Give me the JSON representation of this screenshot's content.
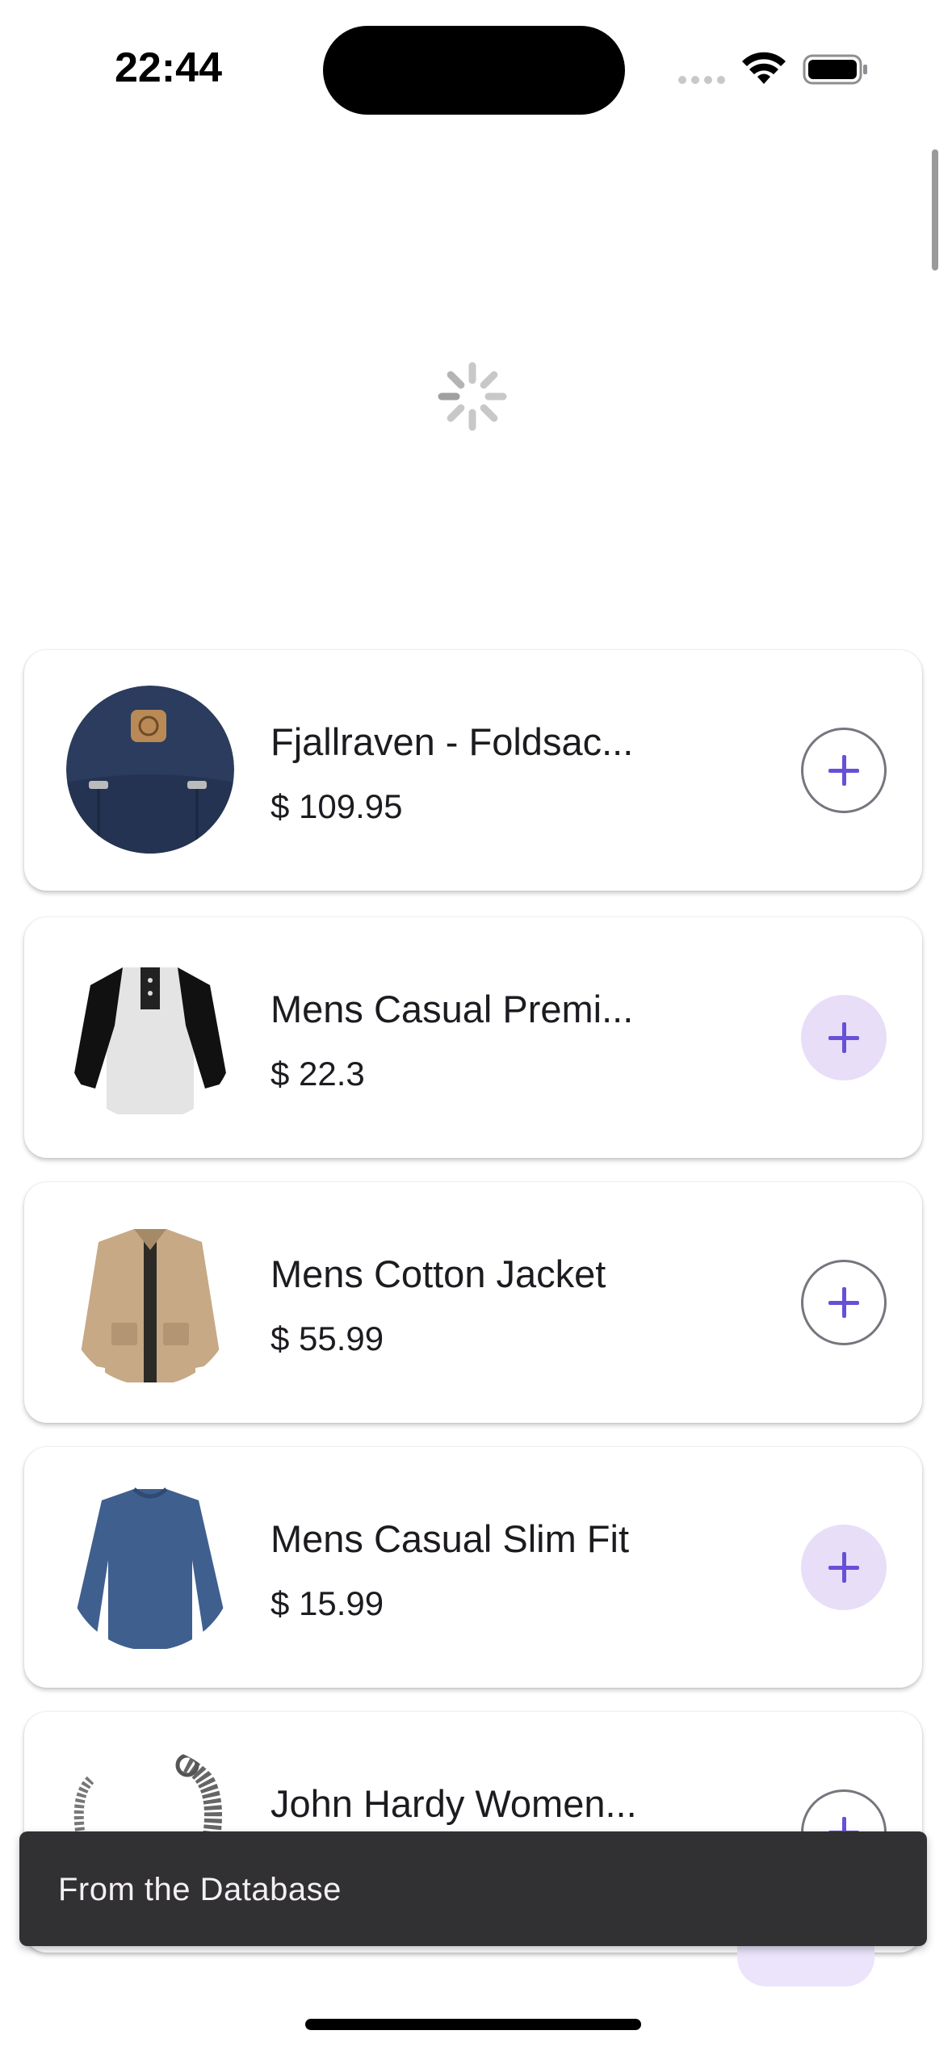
{
  "status_bar": {
    "time": "22:44"
  },
  "products": [
    {
      "title": "Fjallraven - Foldsac...",
      "price": "$ 109.95",
      "image": "backpack-image",
      "button_style": "outlined"
    },
    {
      "title": "Mens Casual Premi...",
      "price": "$ 22.3",
      "image": "henley-shirt-image",
      "button_style": "tonal"
    },
    {
      "title": "Mens Cotton Jacket",
      "price": "$ 55.99",
      "image": "cotton-jacket-image",
      "button_style": "outlined"
    },
    {
      "title": "Mens Casual Slim Fit",
      "price": "$ 15.99",
      "image": "slim-fit-shirt-image",
      "button_style": "tonal"
    },
    {
      "title": "John Hardy Women...",
      "price": "",
      "image": "bracelet-image",
      "button_style": "outlined"
    }
  ],
  "snackbar": {
    "message": "From the Database"
  },
  "colors": {
    "accent": "#6750d8",
    "tonal_button": "#e8def8",
    "snackbar_bg": "#313033"
  }
}
